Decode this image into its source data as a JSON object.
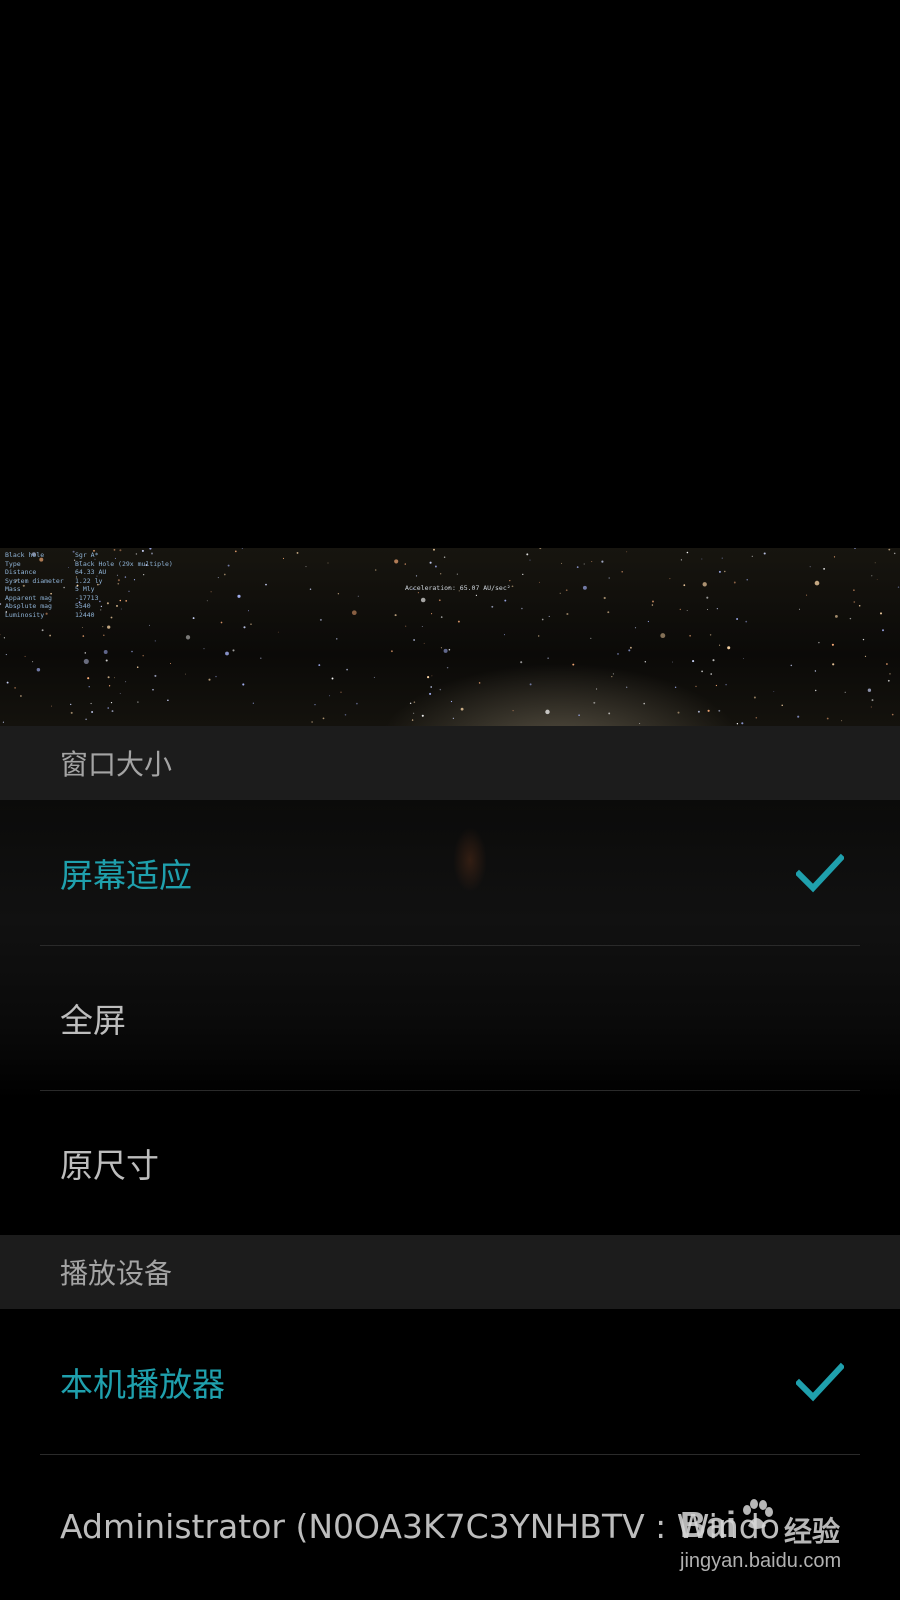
{
  "video": {
    "hud": [
      {
        "k": "Black hole",
        "v": "Sgr A*"
      },
      {
        "k": "Type",
        "v": "Black Hole (29x multiple)"
      },
      {
        "k": "Distance",
        "v": "64.33 AU"
      },
      {
        "k": "System diameter",
        "v": "1.22 ly"
      },
      {
        "k": "Mass",
        "v": "5 Mly"
      },
      {
        "k": "Apparent mag",
        "v": "-17713"
      },
      {
        "k": "Absolute mag",
        "v": "5540"
      },
      {
        "k": "Luminosity",
        "v": "12440"
      }
    ],
    "acceleration": "Acceleration: 65.07 AU/sec²"
  },
  "window_size": {
    "header": "窗口大小",
    "options": [
      {
        "label": "屏幕适应",
        "selected": true
      },
      {
        "label": "全屏",
        "selected": false
      },
      {
        "label": "原尺寸",
        "selected": false
      }
    ]
  },
  "playback_device": {
    "header": "播放设备",
    "options": [
      {
        "label": "本机播放器",
        "selected": true
      },
      {
        "label": "Administrator (N0OA3K7C3YNHBTV : Windo",
        "selected": false
      }
    ]
  },
  "watermark": {
    "brand": "Bai",
    "brand_suffix": "经验",
    "url": "jingyan.baidu.com"
  },
  "colors": {
    "accent": "#1fa0ad",
    "header_bg": "#1c1c1c",
    "text": "#bdbdbd"
  },
  "icons": {
    "check": "checkmark-icon",
    "paw": "baidu-paw-icon"
  }
}
